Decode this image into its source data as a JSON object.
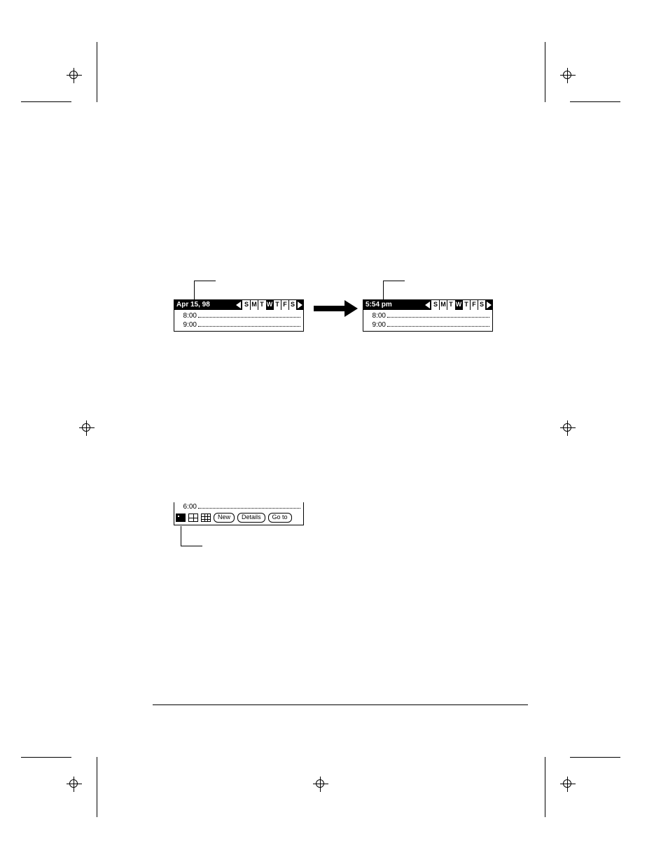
{
  "days": [
    "S",
    "M",
    "T",
    "W",
    "T",
    "F",
    "S"
  ],
  "left_widget": {
    "title": "Apr 15, 98",
    "selected_day_index": 3,
    "rows": [
      "8:00",
      "9:00"
    ]
  },
  "right_widget": {
    "title": "5:54 pm",
    "selected_day_index": 3,
    "rows": [
      "8:00",
      "9:00"
    ]
  },
  "toolbar_snippet": {
    "row_time": "6:00",
    "active_view_index": 0,
    "buttons": {
      "new": "New",
      "details": "Details",
      "goto": "Go to"
    }
  }
}
